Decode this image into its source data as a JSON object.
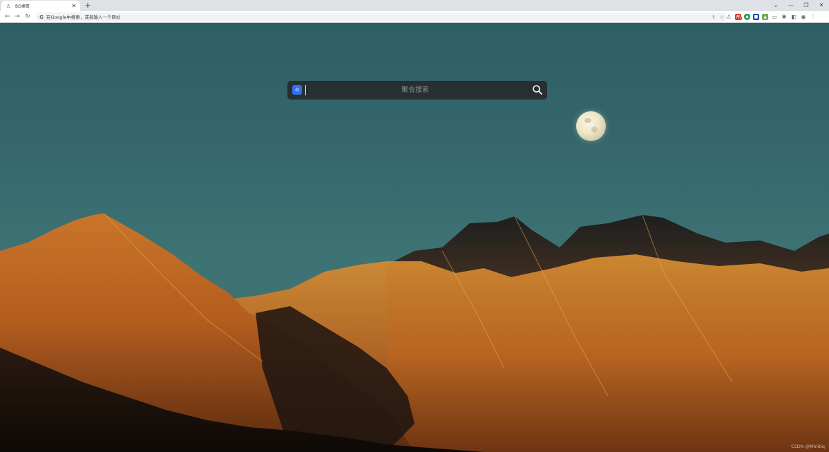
{
  "browser": {
    "tab": {
      "title": "BD桌面",
      "favicon": "person-icon"
    },
    "new_tab": "+",
    "window_controls": [
      "⌄",
      "—",
      "❐",
      "✕"
    ],
    "omnibox": {
      "placeholder": "在Google中搜索，或者输入一个网址"
    }
  },
  "search": {
    "placeholder": "聚合搜索",
    "engine_icon": "search-engine-icon",
    "accent": "#2e70f2"
  },
  "extensions": {
    "badge_count": "15"
  },
  "scene": {
    "sky": "#35676c",
    "mountain": "#c8711f"
  },
  "watermark": "CSDN @Minitiq"
}
